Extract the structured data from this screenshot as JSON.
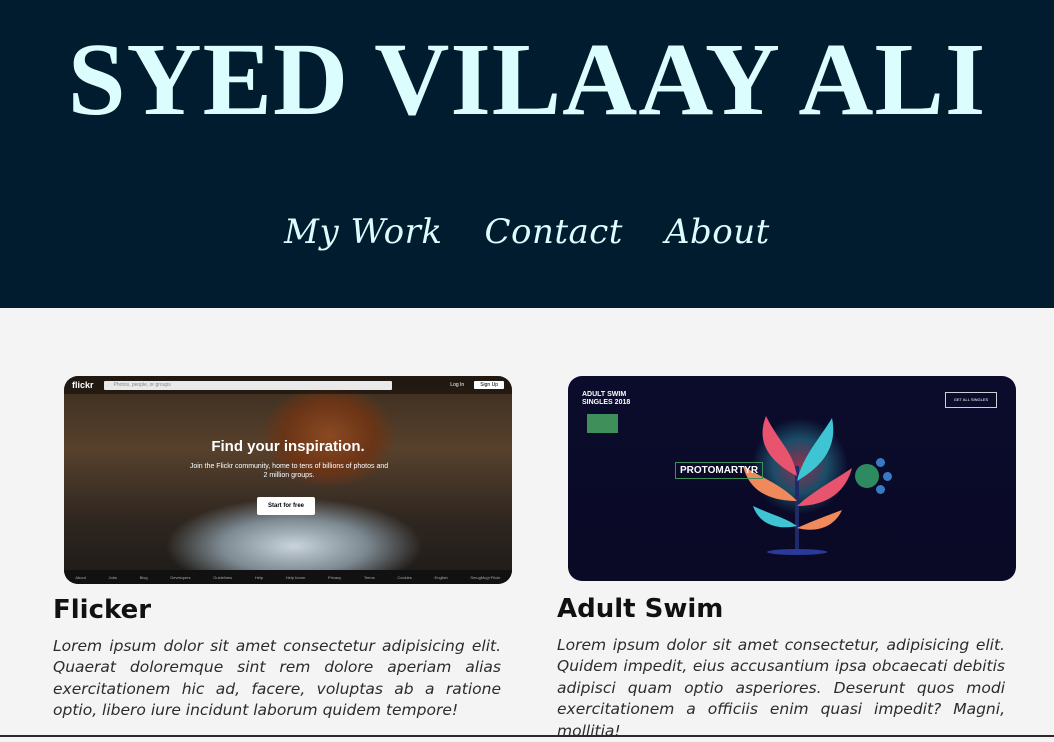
{
  "header": {
    "title": "SYED VILAAY ALI",
    "nav": [
      {
        "label": "My Work"
      },
      {
        "label": "Contact"
      },
      {
        "label": "About"
      }
    ]
  },
  "projects": [
    {
      "title": "Flicker",
      "description": "Lorem ipsum dolor sit amet consectetur adipisicing elit. Quaerat doloremque sint rem dolore aperiam alias exercitationem hic ad, facere, voluptas ab a ratione optio, libero iure incidunt laborum quidem tempore!",
      "screenshot": {
        "logo": "flickr",
        "search_placeholder": "Photos, people, or groups",
        "login": "Log In",
        "signup": "Sign Up",
        "headline": "Find your inspiration.",
        "subtext": "Join the Flickr community, home to tens of billions of photos and 2 million groups.",
        "cta": "Start for free",
        "footer_links": [
          "About",
          "Jobs",
          "Blog",
          "Developers",
          "Guidelines",
          "Help",
          "Help forum",
          "Privacy",
          "Terms",
          "Cookies",
          "English",
          "SmugMug+Flickr"
        ]
      }
    },
    {
      "title": "Adult Swim",
      "description": "Lorem ipsum dolor sit amet consectetur, adipisicing elit. Quidem impedit, eius accusantium ipsa obcaecati debitis adipisci quam optio asperiores. Deserunt quos modi exercitationem a officiis enim quasi impedit? Magni, mollitia!",
      "screenshot": {
        "brand_line1": "ADULT SWIM",
        "brand_line2": "SINGLES 2018",
        "all_singles": "GET ALL SINGLES",
        "band": "PROTOMARTYR"
      }
    }
  ],
  "colors": {
    "header_bg": "#011c2f",
    "header_text": "#dcfdfd",
    "page_bg": "#f4f4f4"
  }
}
